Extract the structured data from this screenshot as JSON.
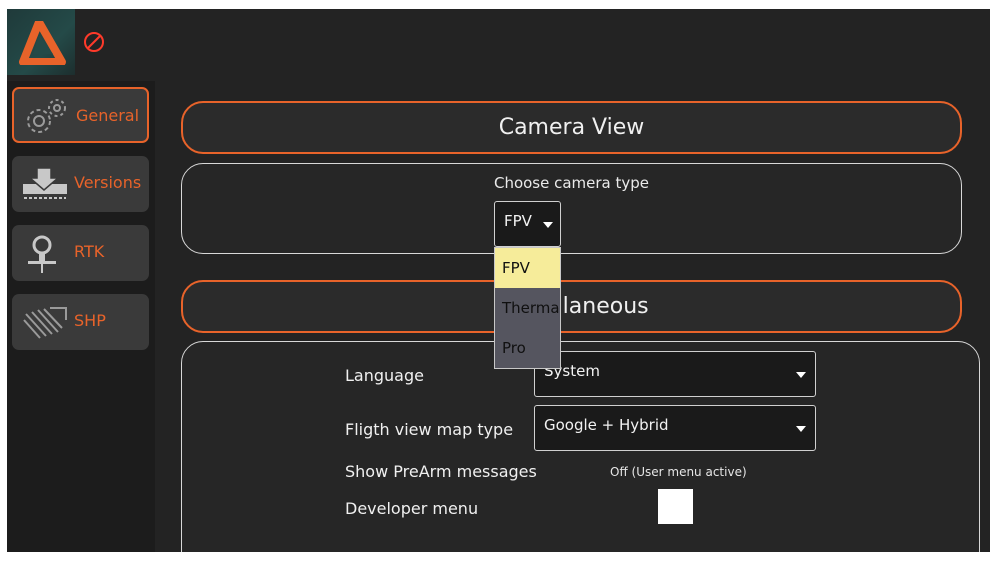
{
  "colors": {
    "accent": "#e8632a",
    "background": "#232323",
    "sidebar": "#1c1c1c",
    "dropdown_selected": "#f6ec9a"
  },
  "sidebar": {
    "items": [
      {
        "label": "General",
        "icon": "gears-icon",
        "active": true
      },
      {
        "label": "Versions",
        "icon": "download-icon",
        "active": false
      },
      {
        "label": "RTK",
        "icon": "rtk-antenna-icon",
        "active": false
      },
      {
        "label": "SHP",
        "icon": "field-rows-icon",
        "active": false
      }
    ]
  },
  "camera": {
    "title": "Camera View",
    "choose_label": "Choose camera type",
    "selected": "FPV",
    "options": [
      "FPV",
      "Therma",
      "Pro"
    ]
  },
  "misc": {
    "title": "Miscellaneous",
    "language_label": "Language",
    "language_value": "System",
    "map_label": "Fligth view map type",
    "map_value": "Google + Hybrid",
    "prearm_label": "Show PreArm messages",
    "prearm_value": "Off  (User menu active)",
    "dev_label": "Developer menu"
  }
}
